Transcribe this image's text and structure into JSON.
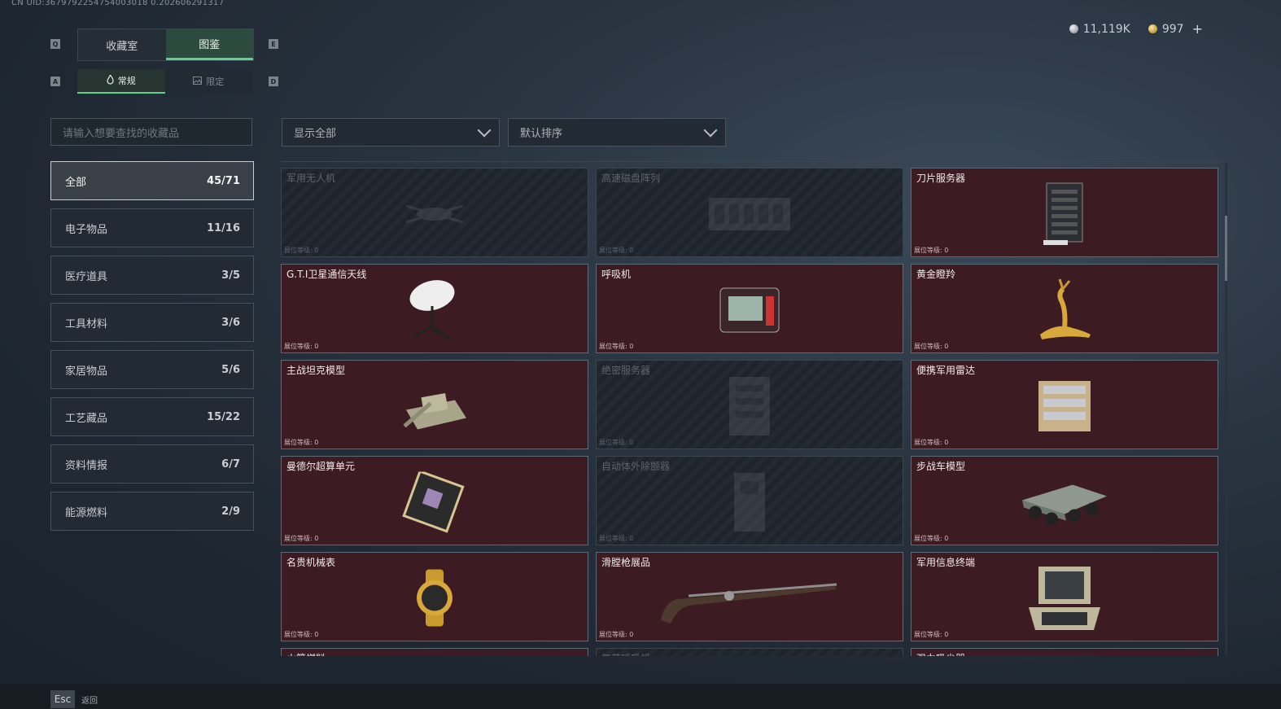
{
  "uid_text": "CN UID:3679792254754003018 0.202606291317",
  "currency": {
    "silver": "11,119K",
    "gold": "997",
    "plus": "+"
  },
  "keys": {
    "q": "Q",
    "e": "E",
    "a": "A",
    "d": "D"
  },
  "tabs": [
    {
      "label": "收藏室",
      "active": false
    },
    {
      "label": "图鉴",
      "active": true
    }
  ],
  "subtabs": [
    {
      "label": "常规",
      "active": true
    },
    {
      "label": "限定",
      "active": false
    }
  ],
  "search": {
    "placeholder": "请输入想要查找的收藏品"
  },
  "filters": {
    "display": "显示全部",
    "sort": "默认排序"
  },
  "categories": [
    {
      "label": "全部",
      "count": "45/71",
      "active": true
    },
    {
      "label": "电子物品",
      "count": "11/16"
    },
    {
      "label": "医疗道具",
      "count": "3/5"
    },
    {
      "label": "工具材料",
      "count": "3/6"
    },
    {
      "label": "家居物品",
      "count": "5/6"
    },
    {
      "label": "工艺藏品",
      "count": "15/22"
    },
    {
      "label": "资料情报",
      "count": "6/7"
    },
    {
      "label": "能源燃料",
      "count": "2/9"
    }
  ],
  "items": [
    {
      "name": "军用无人机",
      "level": "展位等级: 0",
      "locked": true,
      "icon": "drone-icon"
    },
    {
      "name": "高速磁盘阵列",
      "level": "展位等级: 0",
      "locked": true,
      "icon": "disk-array-icon"
    },
    {
      "name": "刀片服务器",
      "level": "展位等级: 0",
      "locked": false,
      "icon": "blade-server-icon"
    },
    {
      "name": "G.T.I卫星通信天线",
      "level": "展位等级: 0",
      "locked": false,
      "icon": "satellite-dish-icon"
    },
    {
      "name": "呼吸机",
      "level": "展位等级: 0",
      "locked": false,
      "icon": "ventilator-icon"
    },
    {
      "name": "黄金瞪羚",
      "level": "展位等级: 0",
      "locked": false,
      "icon": "gold-gazelle-icon"
    },
    {
      "name": "主战坦克模型",
      "level": "展位等级: 0",
      "locked": false,
      "icon": "tank-model-icon"
    },
    {
      "name": "绝密服务器",
      "level": "展位等级: 0",
      "locked": true,
      "icon": "secret-server-icon"
    },
    {
      "name": "便携军用雷达",
      "level": "展位等级: 0",
      "locked": false,
      "icon": "radar-icon"
    },
    {
      "name": "曼德尔超算单元",
      "level": "展位等级: 0",
      "locked": false,
      "icon": "supercomputer-chip-icon"
    },
    {
      "name": "自动体外除颤器",
      "level": "展位等级: 0",
      "locked": true,
      "icon": "defibrillator-icon"
    },
    {
      "name": "步战车模型",
      "level": "展位等级: 0",
      "locked": false,
      "icon": "ifv-model-icon"
    },
    {
      "name": "名贵机械表",
      "level": "展位等级: 0",
      "locked": false,
      "icon": "watch-icon"
    },
    {
      "name": "滑膛枪展品",
      "level": "展位等级: 0",
      "locked": false,
      "icon": "musket-icon"
    },
    {
      "name": "军用信息终端",
      "level": "展位等级: 0",
      "locked": false,
      "icon": "terminal-icon"
    },
    {
      "name": "火箭燃料",
      "level": "",
      "locked": false,
      "icon": "rocket-fuel-icon"
    },
    {
      "name": "复苏呼吸机",
      "level": "",
      "locked": true,
      "icon": "resus-icon"
    },
    {
      "name": "强力吸尘器",
      "level": "",
      "locked": false,
      "icon": "vacuum-icon"
    }
  ],
  "footer": {
    "esc_key": "Esc",
    "back_label": "返回"
  }
}
